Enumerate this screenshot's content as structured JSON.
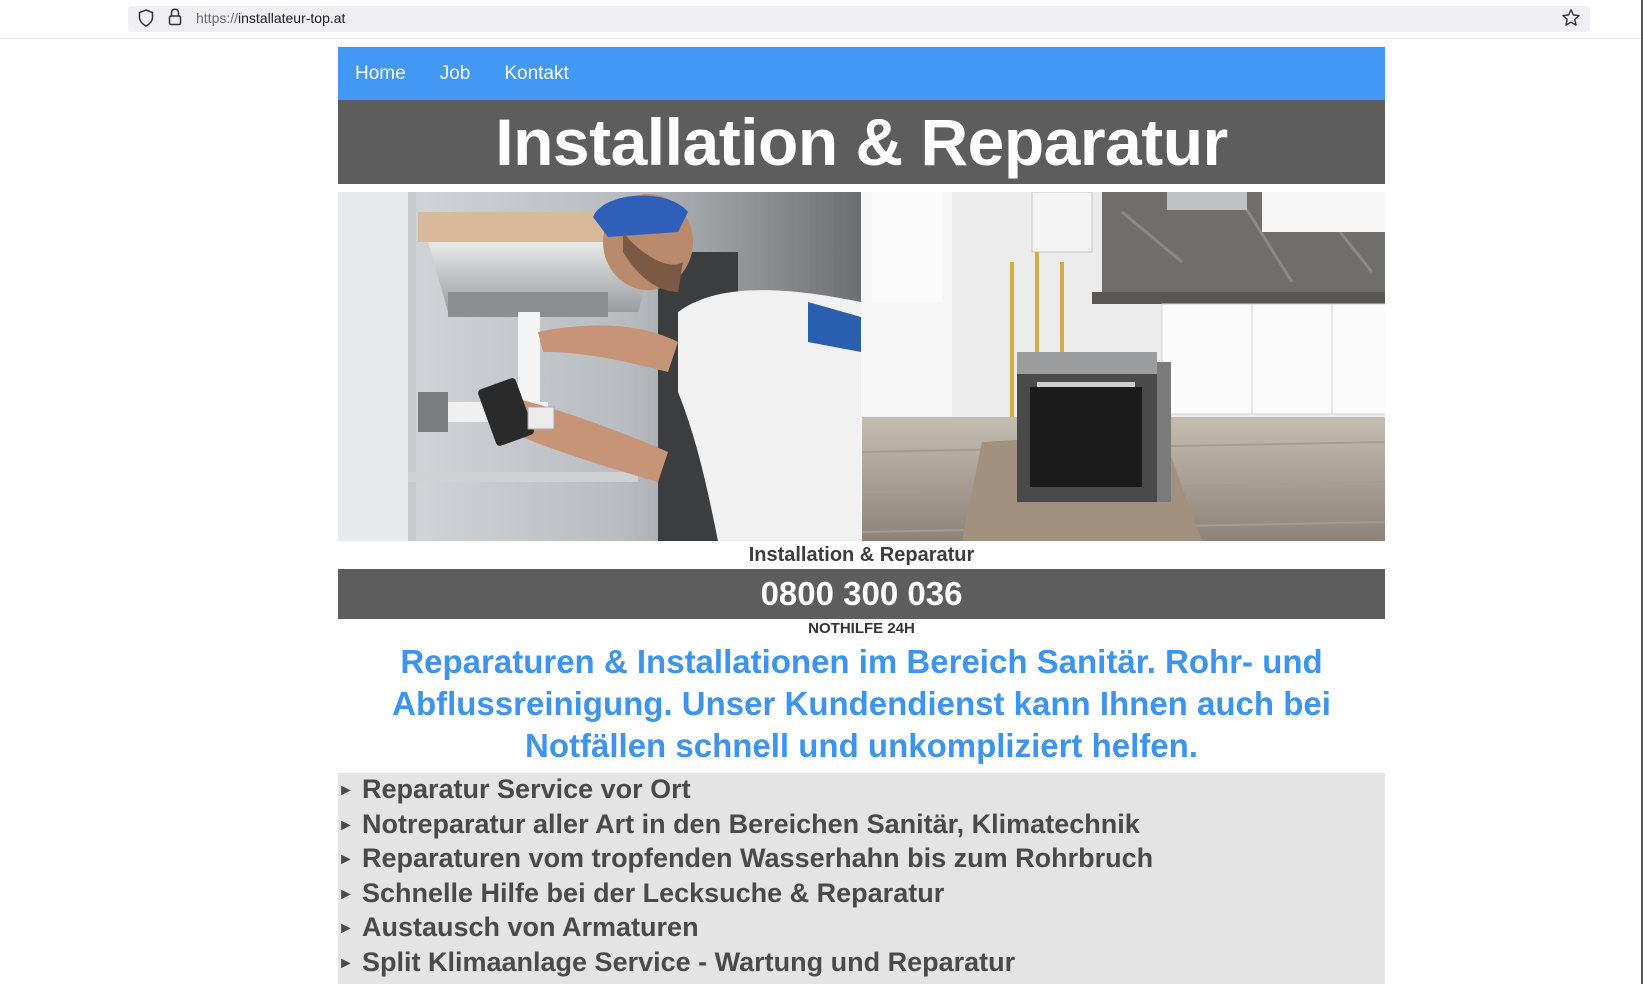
{
  "browser": {
    "url_protocol": "https://",
    "url_host": "installateur-top.at"
  },
  "nav": {
    "items": [
      "Home",
      "Job",
      "Kontakt"
    ]
  },
  "hero": {
    "title": "Installation & Reparatur"
  },
  "caption": "Installation & Reparatur",
  "phone": "0800 300 036",
  "notice": "NOTHILFE 24H",
  "intro": "Reparaturen & Installationen im Bereich Sanitär. Rohr- und Abflussreinigung. Unser Kundendienst kann Ihnen auch bei Notfällen schnell und unkompliziert helfen.",
  "features": [
    "Reparatur Service vor Ort",
    "Notreparatur aller Art in den Bereichen Sanitär, Klimatechnik",
    "Reparaturen vom tropfenden Wasserhahn bis zum Rohrbruch",
    "Schnelle Hilfe bei der Lecksuche & Reparatur",
    "Austausch von Armaturen",
    "Split Klimaanlage Service - Wartung und Reparatur"
  ],
  "colors": {
    "nav_bg": "#4397f5",
    "title_bar_bg": "#5d5d5d",
    "intro_text": "#3d94ee",
    "features_bg": "#e4e4e4"
  }
}
